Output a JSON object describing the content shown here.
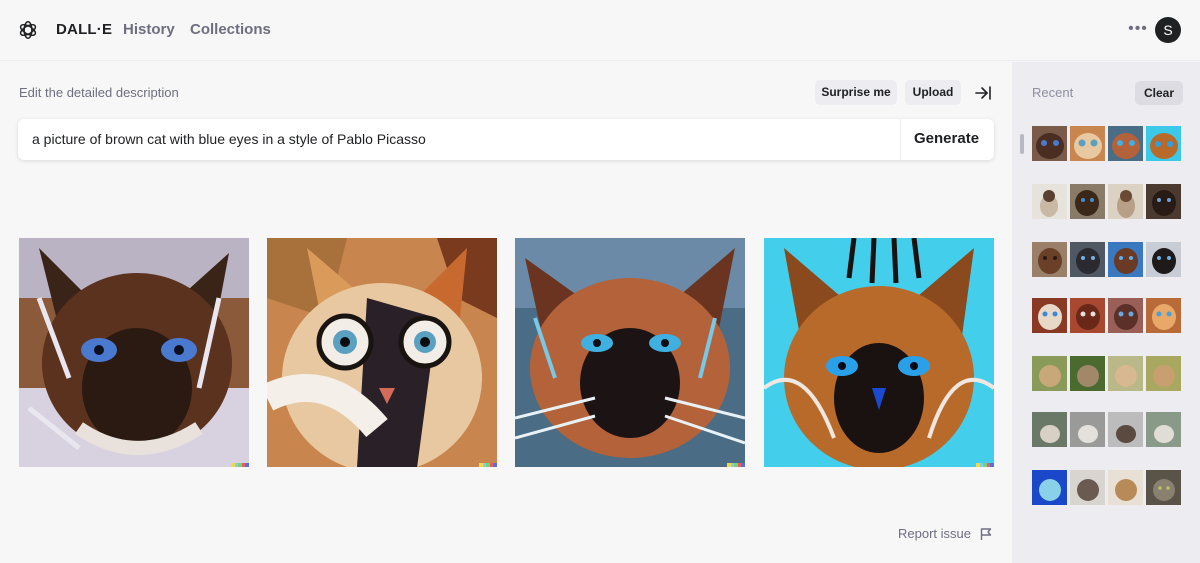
{
  "header": {
    "brand": "DALL·E",
    "nav": [
      "History",
      "Collections"
    ],
    "more_icon": "ellipsis-icon",
    "avatar_initial": "S"
  },
  "editor": {
    "label": "Edit the detailed description",
    "surprise_label": "Surprise me",
    "upload_label": "Upload",
    "collapse_icon": "arrow-right-to-line-icon",
    "prompt_value": "a picture of brown cat with blue eyes in a style of Pablo Picasso",
    "generate_label": "Generate"
  },
  "results": [
    {
      "name": "cat-painting-1"
    },
    {
      "name": "cat-painting-2"
    },
    {
      "name": "cat-painting-3"
    },
    {
      "name": "cat-painting-4"
    }
  ],
  "footer": {
    "report_label": "Report issue",
    "flag_icon": "flag-icon"
  },
  "sidebar": {
    "recent_label": "Recent",
    "clear_label": "Clear"
  },
  "colors": {
    "background": "#f7f7f8",
    "sidebar": "#ececf1",
    "text": "#202123",
    "muted": "#6e6e80"
  }
}
